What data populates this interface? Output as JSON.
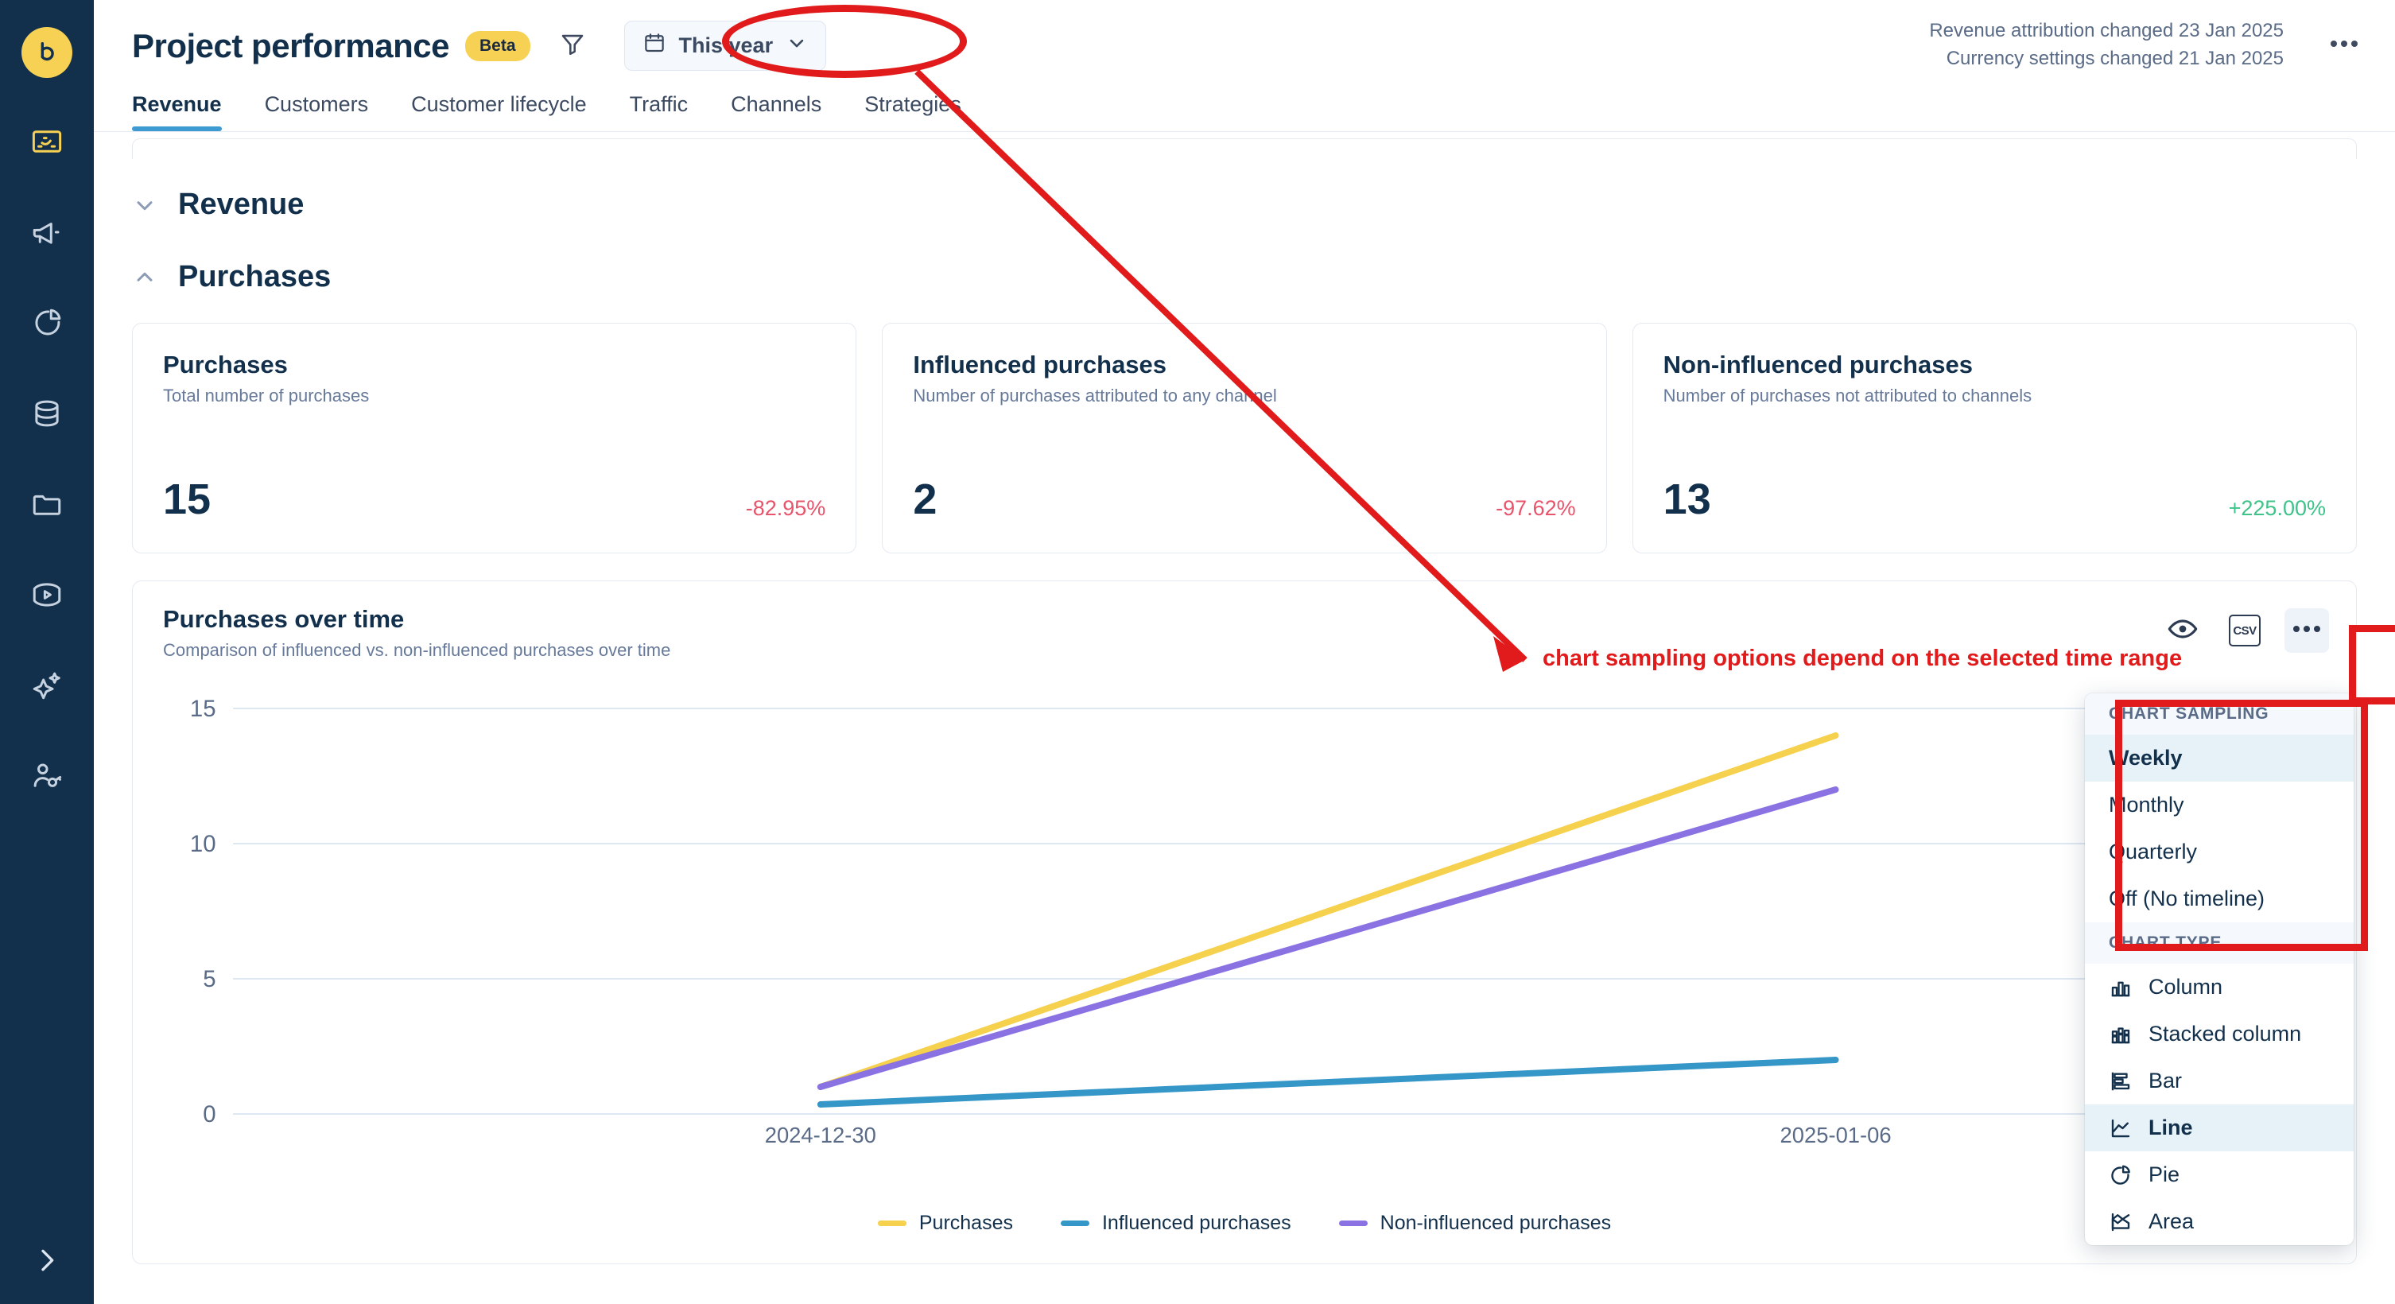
{
  "sidebar": {
    "logo_label": "b",
    "items": [
      {
        "icon": "dashboard-icon",
        "name": "sidebar-item-dashboard"
      },
      {
        "icon": "megaphone-icon",
        "name": "sidebar-item-campaigns"
      },
      {
        "icon": "pie-chart-icon",
        "name": "sidebar-item-analytics"
      },
      {
        "icon": "database-icon",
        "name": "sidebar-item-data"
      },
      {
        "icon": "folder-icon",
        "name": "sidebar-item-files"
      },
      {
        "icon": "play-icon",
        "name": "sidebar-item-media"
      },
      {
        "icon": "sparkle-icon",
        "name": "sidebar-item-ai"
      },
      {
        "icon": "user-key-icon",
        "name": "sidebar-item-access"
      }
    ],
    "expand_label": "Expand"
  },
  "header": {
    "title": "Project performance",
    "badge": "Beta",
    "filter_icon": "filter-icon",
    "date_range": {
      "label": "This year",
      "icon": "calendar-icon",
      "chevron": "chevron-down-icon"
    },
    "notices": [
      "Revenue attribution changed 23 Jan 2025",
      "Currency settings changed 21 Jan 2025"
    ],
    "more_icon": "ellipsis-icon"
  },
  "tabs": [
    {
      "label": "Revenue",
      "active": true
    },
    {
      "label": "Customers",
      "active": false
    },
    {
      "label": "Customer lifecycle",
      "active": false
    },
    {
      "label": "Traffic",
      "active": false
    },
    {
      "label": "Channels",
      "active": false
    },
    {
      "label": "Strategies",
      "active": false
    }
  ],
  "sections": [
    {
      "title": "Revenue",
      "expanded": true,
      "chevron": "chevron-down-icon"
    },
    {
      "title": "Purchases",
      "expanded": true,
      "chevron": "chevron-up-icon"
    }
  ],
  "kpis": [
    {
      "title": "Purchases",
      "subtitle": "Total number of purchases",
      "value": "15",
      "delta": "-82.95%",
      "delta_dir": "negative"
    },
    {
      "title": "Influenced purchases",
      "subtitle": "Number of purchases attributed to any channel",
      "value": "2",
      "delta": "-97.62%",
      "delta_dir": "negative"
    },
    {
      "title": "Non-influenced purchases",
      "subtitle": "Number of purchases not attributed to channels",
      "value": "13",
      "delta": "+225.00%",
      "delta_dir": "positive"
    }
  ],
  "chart_card": {
    "title": "Purchases over time",
    "subtitle": "Comparison of influenced vs. non-influenced purchases over time",
    "tools": [
      {
        "name": "eye-icon",
        "label": "Toggle visibility"
      },
      {
        "name": "csv-icon",
        "label": "CSV"
      },
      {
        "name": "ellipsis-icon",
        "label": "More options",
        "active": true
      }
    ]
  },
  "chart_data": {
    "type": "line",
    "title": "Purchases over time",
    "subtitle": "Comparison of influenced vs. non-influenced purchases over time",
    "x": [
      "2024-12-30",
      "2025-01-06"
    ],
    "xlabel": "",
    "ylabel": "",
    "ylim": [
      0,
      15
    ],
    "yticks": [
      0,
      5,
      10,
      15
    ],
    "grid": true,
    "legend_position": "bottom",
    "series": [
      {
        "name": "Purchases",
        "color": "#f5d14e",
        "values": [
          1,
          14
        ]
      },
      {
        "name": "Influenced purchases",
        "color": "#3596c8",
        "values": [
          0.4,
          2
        ]
      },
      {
        "name": "Non-influenced purchases",
        "color": "#8a72e3",
        "values": [
          1,
          12
        ]
      }
    ]
  },
  "menu": {
    "groups": [
      {
        "label": "CHART SAMPLING",
        "items": [
          {
            "label": "Weekly",
            "selected": true,
            "icon": null
          },
          {
            "label": "Monthly",
            "selected": false,
            "icon": null
          },
          {
            "label": "Quarterly",
            "selected": false,
            "icon": null
          },
          {
            "label": "Off (No timeline)",
            "selected": false,
            "icon": null
          }
        ]
      },
      {
        "label": "CHART TYPE",
        "items": [
          {
            "label": "Column",
            "selected": false,
            "icon": "column-chart-icon"
          },
          {
            "label": "Stacked column",
            "selected": false,
            "icon": "stacked-column-chart-icon"
          },
          {
            "label": "Bar",
            "selected": false,
            "icon": "bar-chart-icon"
          },
          {
            "label": "Line",
            "selected": true,
            "icon": "line-chart-icon"
          },
          {
            "label": "Pie",
            "selected": false,
            "icon": "pie-chart-icon"
          },
          {
            "label": "Area",
            "selected": false,
            "icon": "area-chart-icon"
          }
        ]
      }
    ]
  },
  "annotations": {
    "callout_text": "chart sampling options depend on the selected time range",
    "color": "#e11b1b"
  }
}
